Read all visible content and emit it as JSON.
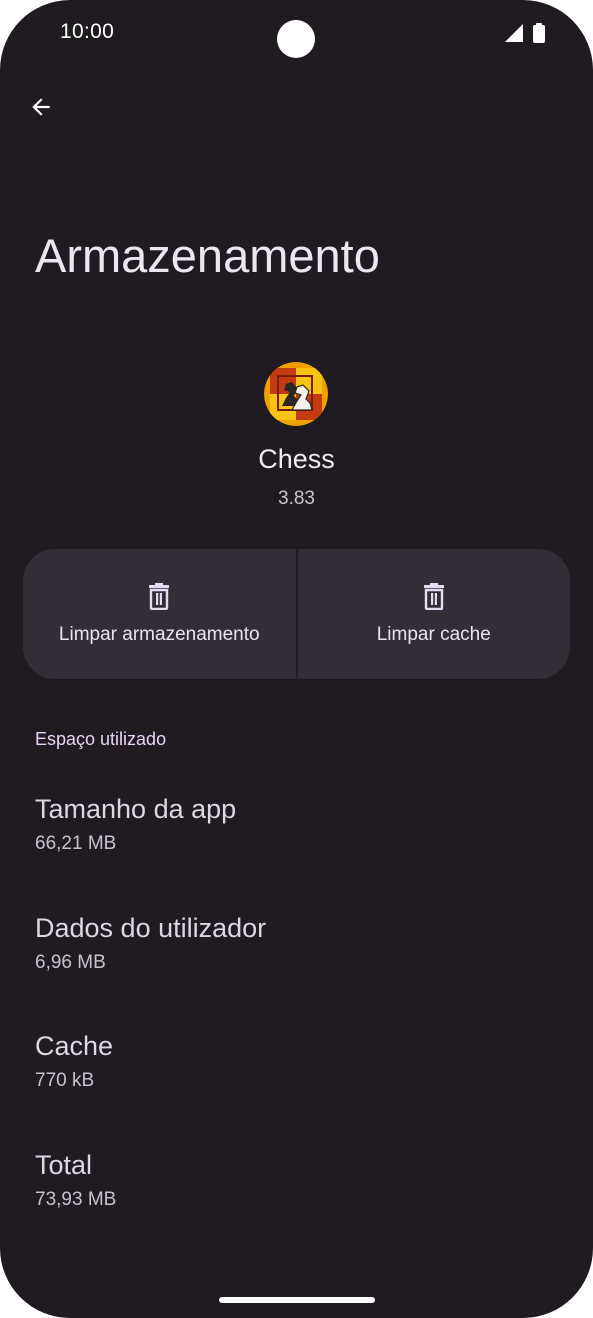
{
  "status_bar": {
    "time": "10:00",
    "signal_icon": "signal-icon",
    "battery_icon": "battery-icon"
  },
  "header": {
    "back_icon": "arrow-back-icon",
    "title": "Armazenamento"
  },
  "app": {
    "icon": "chess-app-icon",
    "name": "Chess",
    "version": "3.83"
  },
  "actions": [
    {
      "icon": "trash-icon",
      "label": "Limpar armazenamento"
    },
    {
      "icon": "trash-icon",
      "label": "Limpar cache"
    }
  ],
  "section": {
    "title": "Espaço utilizado"
  },
  "storage_items": [
    {
      "title": "Tamanho da app",
      "value": "66,21 MB"
    },
    {
      "title": "Dados do utilizador",
      "value": "6,96 MB"
    },
    {
      "title": "Cache",
      "value": "770 kB"
    },
    {
      "title": "Total",
      "value": "73,93 MB"
    }
  ],
  "colors": {
    "background": "#1f1b20",
    "button": "#322e35",
    "accent_text": "#e6d6f4"
  }
}
